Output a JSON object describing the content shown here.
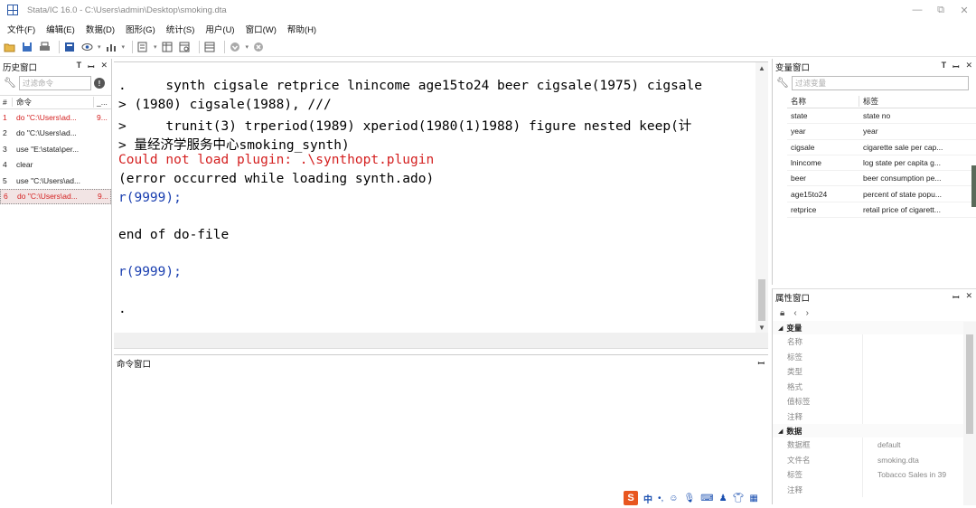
{
  "window": {
    "title": "Stata/IC 16.0 - C:\\Users\\admin\\Desktop\\smoking.dta",
    "minimize": "—",
    "restore": "⧉",
    "close": "✕"
  },
  "menu": [
    "文件(F)",
    "编辑(E)",
    "数据(D)",
    "图形(G)",
    "统计(S)",
    "用户(U)",
    "窗口(W)",
    "帮助(H)"
  ],
  "history": {
    "title": "历史窗口",
    "filter_placeholder": "过滤命令",
    "col_num": "#",
    "col_cmd": "命令",
    "col_rc": "_...",
    "rows": [
      {
        "n": "1",
        "cmd": "do \"C:\\Users\\ad...",
        "rc": "9...",
        "error": true,
        "selected": false
      },
      {
        "n": "2",
        "cmd": "do \"C:\\Users\\ad...",
        "rc": "",
        "error": false,
        "selected": false
      },
      {
        "n": "3",
        "cmd": "use \"E:\\stata\\per...",
        "rc": "",
        "error": false,
        "selected": false
      },
      {
        "n": "4",
        "cmd": "clear",
        "rc": "",
        "error": false,
        "selected": false
      },
      {
        "n": "5",
        "cmd": "use \"C:\\Users\\ad...",
        "rc": "",
        "error": false,
        "selected": false
      },
      {
        "n": "6",
        "cmd": "do \"C:\\Users\\ad...",
        "rc": "9...",
        "error": true,
        "selected": true
      }
    ]
  },
  "results": {
    "lines": [
      {
        "text": ".     synth cigsale retprice lnincome age15to24 beer cigsale(1975) cigsale",
        "style": "black"
      },
      {
        "text": "> (1980) cigsale(1988), ///",
        "style": "black"
      },
      {
        "text": ">     trunit(3) trperiod(1989) xperiod(1980(1)1988) figure nested keep(计",
        "style": "black"
      },
      {
        "text": "> 量经济学服务中心smoking_synth)",
        "style": "black"
      },
      {
        "text": "Could not load plugin: .\\synthopt.plugin",
        "style": "red"
      },
      {
        "text": "(error occurred while loading synth.ado)",
        "style": "black"
      },
      {
        "text": "r(9999);",
        "style": "blue"
      },
      {
        "text": "",
        "style": "black"
      },
      {
        "text": "end of do-file",
        "style": "black"
      },
      {
        "text": "",
        "style": "black"
      },
      {
        "text": "r(9999);",
        "style": "blue"
      },
      {
        "text": "",
        "style": "black"
      },
      {
        "text": ".",
        "style": "black"
      }
    ]
  },
  "command_window": {
    "title": "命令窗口",
    "value": ""
  },
  "variables": {
    "title": "变量窗口",
    "filter_placeholder": "过滤变量",
    "col_name": "名称",
    "col_label": "标签",
    "rows": [
      {
        "name": "state",
        "label": "state no"
      },
      {
        "name": "year",
        "label": "year"
      },
      {
        "name": "cigsale",
        "label": "cigarette sale per cap..."
      },
      {
        "name": "lnincome",
        "label": "log state per capita g..."
      },
      {
        "name": "beer",
        "label": "beer consumption pe..."
      },
      {
        "name": "age15to24",
        "label": "percent of state popu..."
      },
      {
        "name": "retprice",
        "label": "retail price of cigarett..."
      }
    ]
  },
  "properties": {
    "title": "属性窗口",
    "groups": [
      {
        "name": "变量",
        "rows": [
          {
            "k": "名称",
            "v": ""
          },
          {
            "k": "标签",
            "v": ""
          },
          {
            "k": "类型",
            "v": ""
          },
          {
            "k": "格式",
            "v": ""
          },
          {
            "k": "值标签",
            "v": ""
          },
          {
            "k": "注释",
            "v": ""
          }
        ]
      },
      {
        "name": "数据",
        "rows": [
          {
            "k": "数据框",
            "v": "default"
          },
          {
            "k": "文件名",
            "v": "smoking.dta"
          },
          {
            "k": "标签",
            "v": "Tobacco Sales in 39"
          },
          {
            "k": "注释",
            "v": ""
          }
        ]
      }
    ]
  },
  "ime": {
    "logo": "S",
    "mode": "中",
    "icons": [
      "punctuation-icon",
      "emoji-icon",
      "microphone-icon",
      "keyboard-icon",
      "user-icon",
      "shirt-icon",
      "grid-icon"
    ]
  },
  "colors": {
    "error_red": "#d42020",
    "rc_blue": "#1a3fb0",
    "ime_orange": "#e8561f"
  }
}
